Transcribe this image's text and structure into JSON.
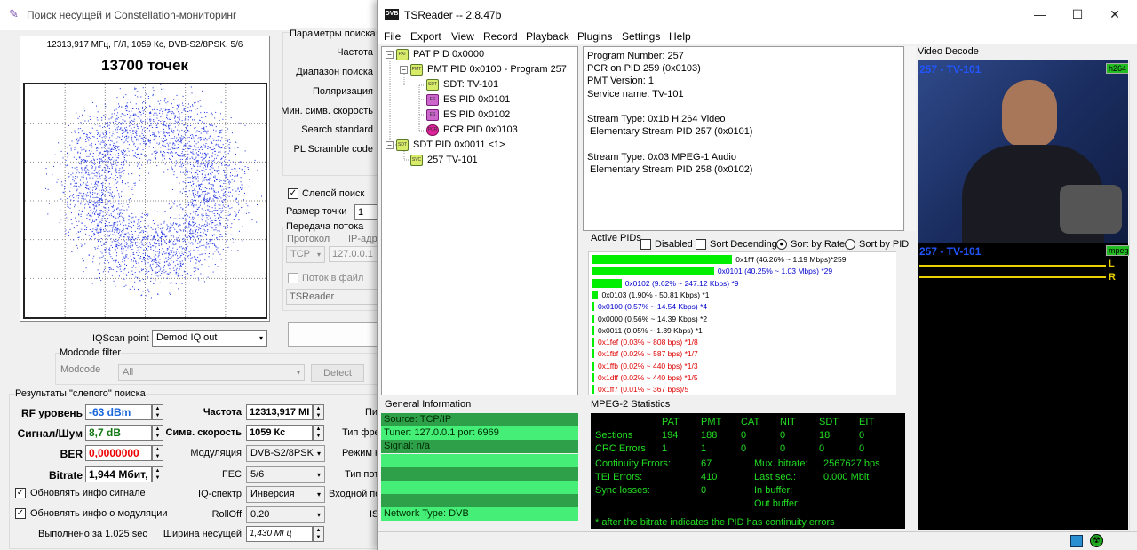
{
  "left_window": {
    "title": "Поиск несущей и Constellation-мониторинг",
    "constellation": {
      "header": "12313,917 МГц, Г/Л, 1059 Кс, DVB-S2/8PSK, 5/6",
      "points": "13700 точек"
    },
    "params": {
      "group_title": "Параметры поиска",
      "labels": [
        "Частота",
        "Диапазон поиска",
        "Поляризация",
        "Мин. симв. скорость",
        "Search standard",
        "PL Scramble code"
      ],
      "blind_search": "Слепой поиск",
      "blind_checked": true,
      "point_size_label": "Размер точки",
      "point_size_value": "1",
      "stream_group": "Передача потока",
      "protocol_label": "Протокол",
      "ip_label": "IP-адре",
      "protocol_value": "TCP",
      "ip_value": "127.0.0.1",
      "to_file": "Поток в файл",
      "tsreader": "TSReader"
    },
    "iqscan": {
      "label": "IQScan point",
      "value": "Demod IQ out"
    },
    "modcode": {
      "group": "Modcode filter",
      "label": "Modcode",
      "value": "All",
      "detect": "Detect"
    },
    "results": {
      "group": "Результаты \"слепого\" поиска",
      "rf_label": "RF уровень",
      "rf_value": "-63 dBm",
      "snr_label": "Сигнал/Шум",
      "snr_value": "8,7 dB",
      "ber_label": "BER",
      "ber_value": "0,0000000",
      "bitrate_label": "Bitrate",
      "bitrate_value": "1,944 Мбит,",
      "upd_signal": "Обновлять инфо сигнале",
      "upd_mod": "Обновлять инфо о модуляции",
      "done": "Выполнено за 1.025 sec",
      "freq_label": "Частота",
      "freq_value": "12313,917 МІ",
      "sr_label": "Симв. скорость",
      "sr_value": "1059 Кс",
      "mod_label": "Модуляция",
      "mod_value": "DVB-S2/8PSK",
      "fec_label": "FEC",
      "fec_value": "5/6",
      "iq_label": "IQ-спектр",
      "iq_value": "Инверсия",
      "roll_label": "RollOff",
      "roll_value": "0.20",
      "bw_label": "Ширина несущей",
      "bw_value": "1,430 МГц",
      "extra_labels": [
        "Пи",
        "Тип фре",
        "Режим к",
        "Тип пот",
        "Входной по",
        "IS"
      ]
    }
  },
  "tsreader": {
    "title": "TSReader -- 2.8.47b",
    "logo": "DVB",
    "window_buttons": [
      "—",
      "☐",
      "✕"
    ],
    "menu": [
      "File",
      "Export",
      "View",
      "Record",
      "Playback",
      "Plugins",
      "Settings",
      "Help"
    ],
    "tree": [
      {
        "label": "PAT PID 0x0000",
        "icon": "PAT"
      },
      {
        "label": "PMT PID 0x0100 - Program 257",
        "icon": "PMT"
      },
      {
        "label": "SDT: TV-101",
        "icon": "SDT"
      },
      {
        "label": "ES PID 0x0101",
        "icon": "ES"
      },
      {
        "label": "ES PID 0x0102",
        "icon": "ES"
      },
      {
        "label": "PCR PID 0x0103",
        "icon": "PCR"
      },
      {
        "label": "SDT PID 0x0011 <1>",
        "icon": "SDT"
      },
      {
        "label": "257 TV-101",
        "icon": "SVC"
      }
    ],
    "info": "Program Number: 257\nPCR on PID 259 (0x0103)\nPMT Version: 1\nService name: TV-101\n\nStream Type: 0x1b H.264 Video\n Elementary Stream PID 257 (0x0101)\n\nStream Type: 0x03 MPEG-1 Audio\n Elementary Stream PID 258 (0x0102)",
    "video_decode_label": "Video Decode",
    "video": {
      "top_label": "257 - TV-101",
      "badge": "h264",
      "bottom_label": "257 - TV-101",
      "audio_badge": "mpeg",
      "L": "L",
      "R": "R"
    },
    "active_pids": {
      "label": "Active PIDs",
      "options": [
        "Disabled",
        "Sort Decending",
        "Sort by Rate",
        "Sort by PID"
      ],
      "rows": [
        {
          "text": "0x1fff (46.26% ~ 1.19 Mbps)*259",
          "color": "#000000",
          "pct": 46.26
        },
        {
          "text": "0x0101 (40.25% ~ 1.03 Mbps) *29",
          "color": "#0000cc",
          "pct": 40.25
        },
        {
          "text": "0x0102 (9.62% ~ 247.12 Kbps) *9",
          "color": "#0000cc",
          "pct": 9.62
        },
        {
          "text": "0x0103 (1.90% - 50.81 Kbps) *1",
          "color": "#000000",
          "pct": 1.9
        },
        {
          "text": "0x0100 (0.57% ~ 14.54 Kbps) *4",
          "color": "#0000cc",
          "pct": 0.57
        },
        {
          "text": "0x0000 (0.56% ~ 14.39 Kbps) *2",
          "color": "#000000",
          "pct": 0.56
        },
        {
          "text": "0x0011 (0.05% ~ 1.39 Kbps) *1",
          "color": "#000000",
          "pct": 0.05
        },
        {
          "text": "0x1fef (0.03% ~ 808 bps) *1/8",
          "color": "#dd0000",
          "pct": 0.03
        },
        {
          "text": "0x1fbf (0.02% ~ 587 bps) *1/7",
          "color": "#dd0000",
          "pct": 0.02
        },
        {
          "text": "0x1ffb (0.02% ~ 440 bps) *1/3",
          "color": "#dd0000",
          "pct": 0.02
        },
        {
          "text": "0x1dff (0.02% ~ 440 bps) *1/5",
          "color": "#dd0000",
          "pct": 0.02
        },
        {
          "text": "0x1ff7 (0.01% ~ 367 bps)/5",
          "color": "#dd0000",
          "pct": 0.01
        }
      ]
    },
    "general_info": {
      "label": "General Information",
      "rows": [
        "Source: TCP/IP",
        "Tuner: 127.0.0.1 port 6969",
        "Signal: n/a",
        "",
        "",
        "",
        "",
        "Network Type: DVB"
      ]
    },
    "mpeg2": {
      "label": "MPEG-2 Statistics",
      "headers": [
        "PAT",
        "PMT",
        "CAT",
        "NIT",
        "SDT",
        "EIT"
      ],
      "sections_label": "Sections",
      "sections": [
        "194",
        "188",
        "0",
        "0",
        "18",
        "0"
      ],
      "crc_label": "CRC Errors",
      "crc": [
        "1",
        "1",
        "0",
        "0",
        "0",
        "0"
      ],
      "cont_label": "Continuity Errors:",
      "cont": "67",
      "tei_label": "TEI Errors:",
      "tei": "410",
      "sync_label": "Sync losses:",
      "sync": "0",
      "mux_label": "Mux. bitrate:",
      "mux": "2567627 bps",
      "last_label": "Last sec.:",
      "last": "0.000 Mbit",
      "inbuf_label": "In buffer:",
      "outbuf_label": "Out buffer:",
      "note": "* after the bitrate indicates the PID has continuity errors"
    }
  },
  "constellation_points": 13700
}
